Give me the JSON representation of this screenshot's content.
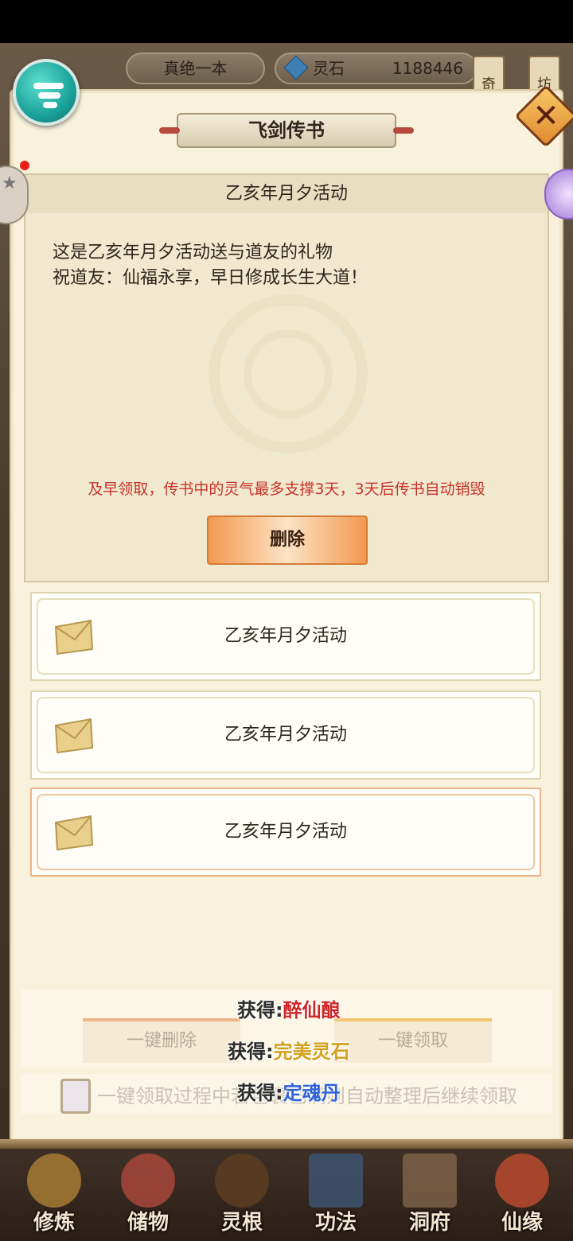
{
  "topbar": {
    "player_name": "真绝一本",
    "currency_label": "灵石",
    "currency_value": "1188446",
    "sign_left": "奇",
    "sign_right": "坊"
  },
  "dialog": {
    "title": "飞剑传书",
    "close_symbol": "✕"
  },
  "detail": {
    "header": "乙亥年月夕活动",
    "body_lines": [
      "这是乙亥年月夕活动送与道友的礼物",
      "祝道友：仙福永享，早日修成长生大道！"
    ],
    "warning": "及早领取，传书中的灵气最多支撑3天，3天后传书自动销毁",
    "delete_label": "删除"
  },
  "mails": [
    {
      "title": "乙亥年月夕活动",
      "selected": false
    },
    {
      "title": "乙亥年月夕活动",
      "selected": false
    },
    {
      "title": "乙亥年月夕活动",
      "selected": true
    }
  ],
  "actions": {
    "delete_all": "一键删除",
    "claim_all": "一键领取",
    "auto_sort_text": "一键领取过程中若包裹已满则自动整理后继续领取",
    "auto_sort_checked": false
  },
  "rewards": [
    {
      "prefix": "获得:",
      "item": "醉仙酿",
      "color": "#d0262a"
    },
    {
      "prefix": "获得:",
      "item": "完美灵石",
      "color": "#d2a11f"
    },
    {
      "prefix": "获得:",
      "item": "定魂丹",
      "color": "#2f63d8"
    }
  ],
  "nav": [
    {
      "label": "修炼",
      "icon": "cultivate-icon"
    },
    {
      "label": "储物",
      "icon": "storage-bag-icon"
    },
    {
      "label": "灵根",
      "icon": "spirit-root-icon"
    },
    {
      "label": "功法",
      "icon": "technique-book-icon"
    },
    {
      "label": "洞府",
      "icon": "cave-house-icon"
    },
    {
      "label": "仙缘",
      "icon": "fortune-icon"
    }
  ],
  "colors": {
    "panel_bg": "#f8f2dc",
    "warning_red": "#c8322a",
    "accent_orange": "#f3994f",
    "menu_teal": "#1aa29a"
  }
}
